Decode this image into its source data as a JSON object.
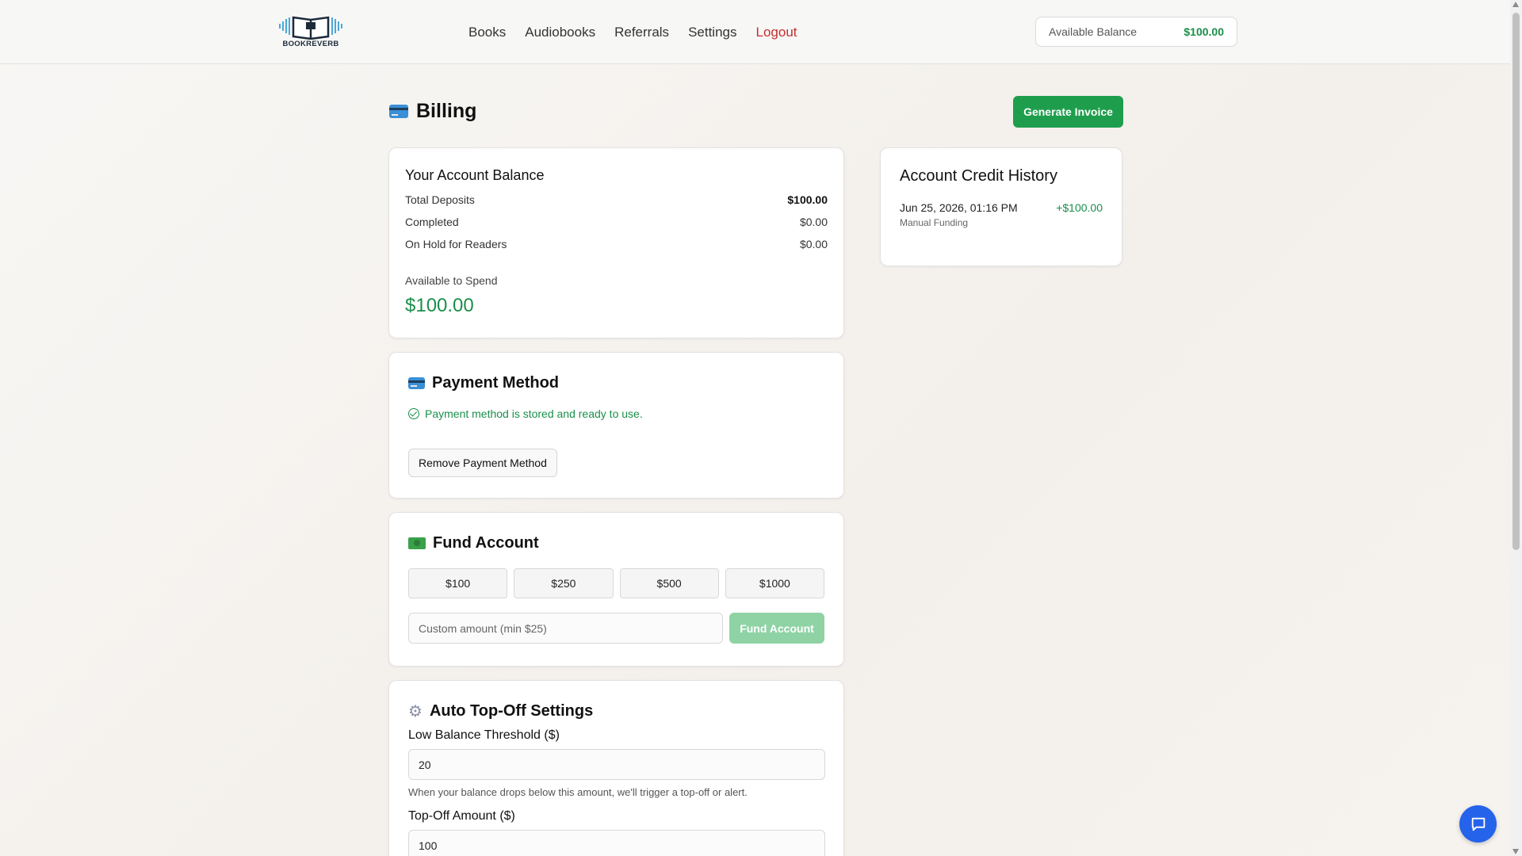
{
  "header": {
    "logo_text": "BOOKREVERB",
    "nav": [
      {
        "label": "Books"
      },
      {
        "label": "Audiobooks"
      },
      {
        "label": "Referrals"
      },
      {
        "label": "Settings"
      },
      {
        "label": "Logout"
      }
    ],
    "balance_label": "Available Balance",
    "balance_value": "$100.00"
  },
  "page": {
    "title": "Billing",
    "generate_invoice_label": "Generate Invoice"
  },
  "balance": {
    "title": "Your Account Balance",
    "rows": [
      {
        "label": "Total Deposits",
        "value": "$100.00"
      },
      {
        "label": "Completed",
        "value": "$0.00"
      },
      {
        "label": "On Hold for Readers",
        "value": "$0.00"
      }
    ],
    "available_label": "Available to Spend",
    "available_value": "$100.00"
  },
  "history": {
    "title": "Account Credit History",
    "items": [
      {
        "date": "Jun 25, 2026, 01:16 PM",
        "type": "Manual Funding",
        "amount": "+$100.00"
      }
    ]
  },
  "payment": {
    "title": "Payment Method",
    "status": "Payment method is stored and ready to use.",
    "remove_label": "Remove Payment Method"
  },
  "fund": {
    "title": "Fund Account",
    "amounts": [
      "$100",
      "$250",
      "$500",
      "$1000"
    ],
    "custom_placeholder": "Custom amount (min $25)",
    "fund_label": "Fund Account"
  },
  "topoff": {
    "title": "Auto Top-Off Settings",
    "threshold_label": "Low Balance Threshold ($)",
    "threshold_value": "20",
    "threshold_help": "When your balance drops below this amount, we'll trigger a top-off or alert.",
    "amount_label": "Top-Off Amount ($)",
    "amount_value": "100"
  },
  "colors": {
    "accent_green": "#1e9e4c",
    "logout_red": "#c62f2f",
    "chat_blue": "#2563eb"
  },
  "icons": [
    "credit-card-icon",
    "check-circle-icon",
    "cash-icon",
    "gear-icon",
    "chat-icon"
  ]
}
